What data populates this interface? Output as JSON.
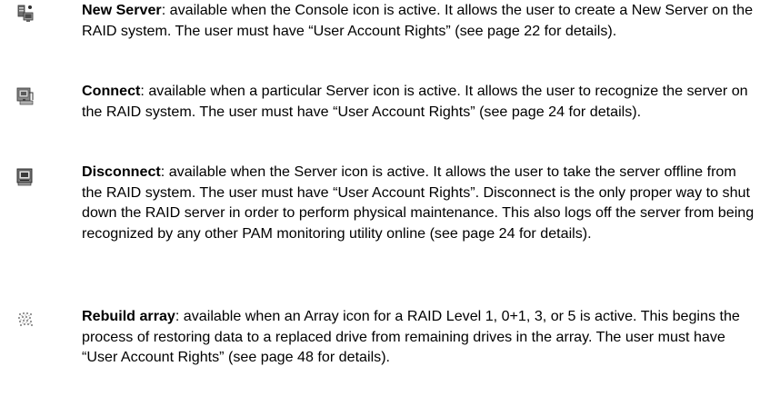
{
  "entries": [
    {
      "icon": "new-server-icon",
      "title": "New Server",
      "body": ": available when the Console icon is active. It allows the user to create a New Server on the RAID system. The user must have “User Account Rights” (see page 22 for details)."
    },
    {
      "icon": "connect-icon",
      "title": "Connect",
      "body": ": available when a particular Server icon is active. It allows the user to recognize the server on the RAID system. The user must have “User Account Rights” (see page 24 for details)."
    },
    {
      "icon": "disconnect-icon",
      "title": "Disconnect",
      "body": ": available when the Server icon is active. It allows the user to take the server offline from the RAID system. The user must have “User Account Rights”. Disconnect is the only proper way to shut down the RAID server in order to perform physical maintenance. This also logs off the server from being recognized by any other PAM monitoring utility online (see page 24 for details)."
    },
    {
      "icon": "rebuild-array-icon",
      "title": "Rebuild array",
      "body": ": available when an Array icon for a RAID Level 1, 0+1, 3, or 5 is active. This begins the process of restoring data to a replaced drive from remaining drives in the array. The user must have “User Account Rights” (see page 48 for details)."
    }
  ]
}
